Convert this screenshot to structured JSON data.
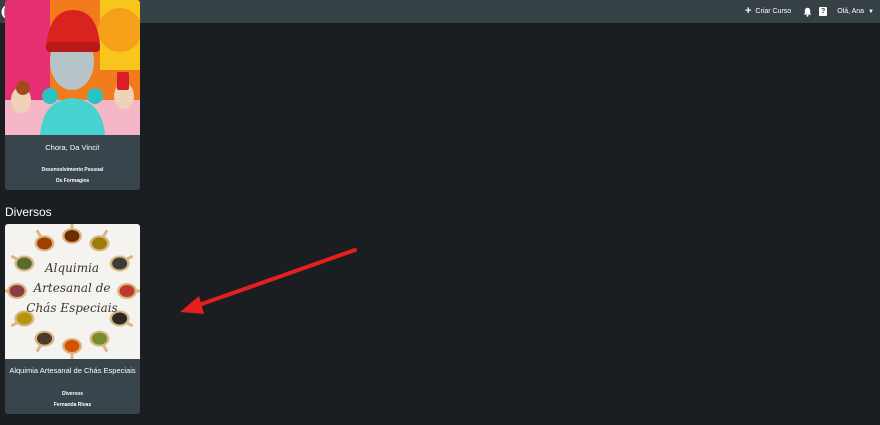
{
  "header": {
    "brand": "nutror",
    "create_label": "Criar Curso",
    "help_glyph": "?",
    "user_greeting": "Olá, Ana"
  },
  "sections": [
    {
      "title": "",
      "courses": [
        {
          "title": "Chora, Da Vinci!",
          "category": "Desenvolvimento Pessoal",
          "author": "Os Formagios"
        }
      ]
    },
    {
      "title": "Diversos",
      "courses": [
        {
          "title": "Alquimia Artesanal de Chás Especiais",
          "category": "Diversos",
          "author": "Fernanda Rivas",
          "cover_text": [
            "Alquimia",
            "Artesanal de",
            "Chás Especiais"
          ]
        }
      ]
    }
  ],
  "colors": {
    "background": "#1a1e21",
    "topbar": "#364146",
    "card": "#39454c",
    "annotation_arrow": "#e3201e"
  },
  "icons": [
    "nutror-logo-icon",
    "plus-icon",
    "bell-icon",
    "help-icon",
    "chevron-down-icon"
  ]
}
